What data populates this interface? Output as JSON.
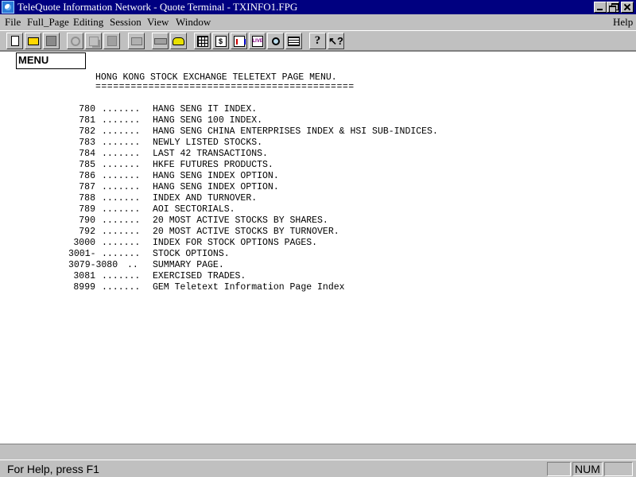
{
  "window": {
    "title": "TeleQuote Information Network - Quote Terminal - TXINFO1.FPG"
  },
  "menubar": {
    "file": "File",
    "full_page": "Full_Page",
    "editing": "Editing",
    "session": "Session",
    "view": "View",
    "window": "Window",
    "help": "Help"
  },
  "toolbar": {
    "buttons": [
      "new-document",
      "open-folder",
      "save-disk",
      "cut",
      "copy",
      "paste",
      "print",
      "keyboard",
      "phone",
      "grid",
      "quote",
      "chart",
      "live",
      "magnify",
      "table",
      "help",
      "context-help"
    ],
    "quote_glyph": "$",
    "live_glyph": "LIVE",
    "help_glyph": "?",
    "context_help_glyph": "↖?"
  },
  "page_box": "MENU",
  "content": {
    "heading": "HONG KONG STOCK EXCHANGE TELETEXT PAGE MENU.",
    "underline": "============================================",
    "items": [
      {
        "code": "780",
        "dots": ".......",
        "desc": "HANG SENG IT INDEX."
      },
      {
        "code": "781",
        "dots": ".......",
        "desc": "HANG SENG 100 INDEX."
      },
      {
        "code": "782",
        "dots": ".......",
        "desc": "HANG SENG CHINA ENTERPRISES INDEX & HSI SUB-INDICES."
      },
      {
        "code": "783",
        "dots": ".......",
        "desc": "NEWLY LISTED STOCKS."
      },
      {
        "code": "784",
        "dots": ".......",
        "desc": "LAST 42 TRANSACTIONS."
      },
      {
        "code": "785",
        "dots": ".......",
        "desc": "HKFE FUTURES PRODUCTS."
      },
      {
        "code": "786",
        "dots": ".......",
        "desc": "HANG SENG INDEX OPTION."
      },
      {
        "code": "787",
        "dots": ".......",
        "desc": "HANG SENG INDEX OPTION."
      },
      {
        "code": "788",
        "dots": ".......",
        "desc": "INDEX AND TURNOVER."
      },
      {
        "code": "789",
        "dots": ".......",
        "desc": "AOI SECTORIALS."
      },
      {
        "code": "790",
        "dots": ".......",
        "desc": "20 MOST ACTIVE STOCKS BY SHARES."
      },
      {
        "code": "792",
        "dots": ".......",
        "desc": "20 MOST ACTIVE STOCKS BY TURNOVER."
      },
      {
        "code": "3000",
        "dots": ".......",
        "desc": "INDEX FOR STOCK OPTIONS PAGES."
      },
      {
        "code": "3001-",
        "dots": ".......",
        "desc": "STOCK OPTIONS."
      },
      {
        "code": "3079-3080",
        "dots": "..",
        "desc": "SUMMARY PAGE."
      },
      {
        "code": "3081",
        "dots": ".......",
        "desc": "EXERCISED TRADES."
      },
      {
        "code": "8999",
        "dots": ".......",
        "desc": "GEM Teletext Information Page Index"
      }
    ]
  },
  "statusbar": {
    "help_text": "For Help, press F1",
    "num": "NUM"
  }
}
